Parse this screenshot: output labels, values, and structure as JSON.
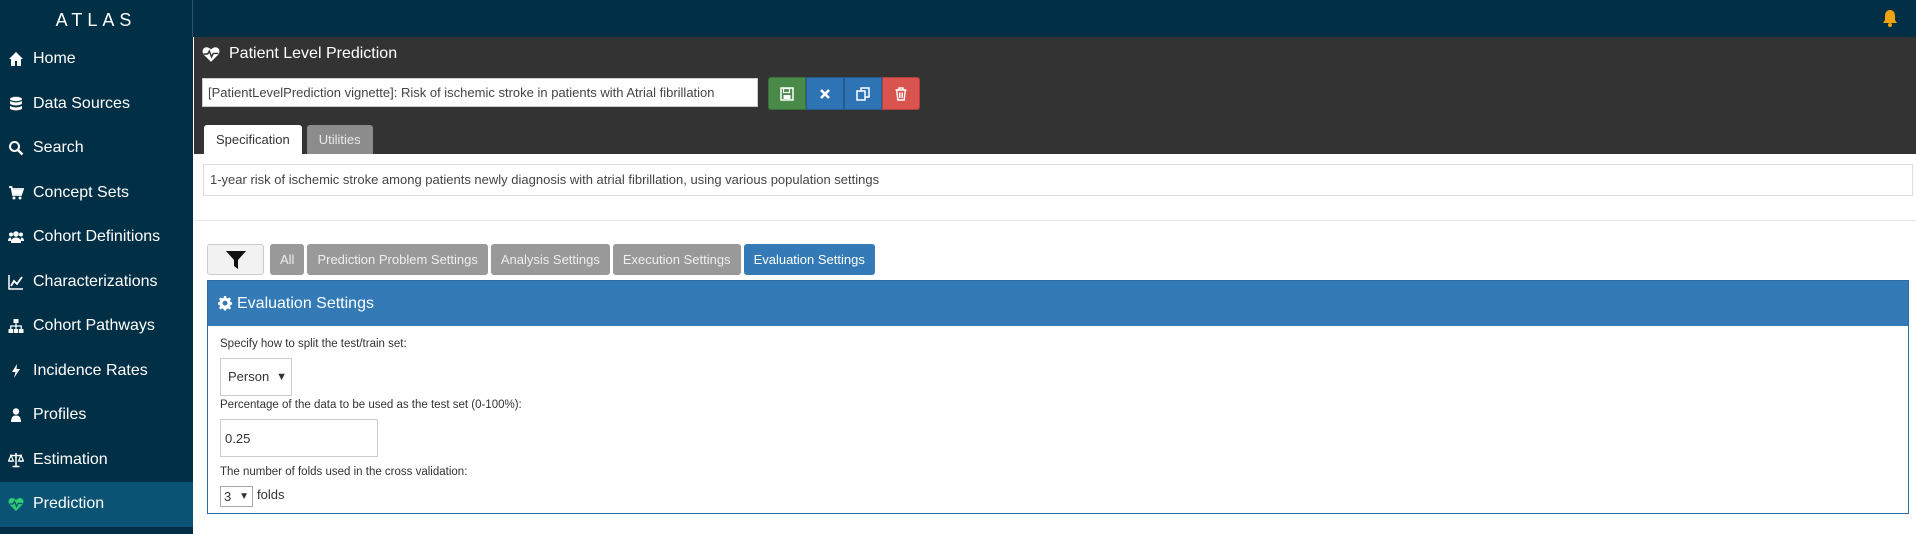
{
  "app": {
    "brand": "ATLAS"
  },
  "nav": {
    "items": [
      {
        "label": "Home",
        "icon": "home-icon"
      },
      {
        "label": "Data Sources",
        "icon": "database-icon"
      },
      {
        "label": "Search",
        "icon": "search-icon"
      },
      {
        "label": "Concept Sets",
        "icon": "cart-icon"
      },
      {
        "label": "Cohort Definitions",
        "icon": "users-icon"
      },
      {
        "label": "Characterizations",
        "icon": "line-chart-icon"
      },
      {
        "label": "Cohort Pathways",
        "icon": "sitemap-icon"
      },
      {
        "label": "Incidence Rates",
        "icon": "bolt-icon"
      },
      {
        "label": "Profiles",
        "icon": "user-icon"
      },
      {
        "label": "Estimation",
        "icon": "balance-scale-icon"
      },
      {
        "label": "Prediction",
        "icon": "heartbeat-icon"
      }
    ],
    "active_index": 10
  },
  "header": {
    "title": "Patient Level Prediction",
    "name_value": "[PatientLevelPrediction vignette]: Risk of ischemic stroke in patients with Atrial fibrillation",
    "tabs": [
      {
        "label": "Specification",
        "active": true
      },
      {
        "label": "Utilities",
        "active": false
      }
    ]
  },
  "description": "1-year risk of ischemic stroke among patients newly diagnosis with atrial fibrillation, using various population settings",
  "filters": {
    "buttons": [
      {
        "label": "All",
        "active": false
      },
      {
        "label": "Prediction Problem Settings",
        "active": false
      },
      {
        "label": "Analysis Settings",
        "active": false
      },
      {
        "label": "Execution Settings",
        "active": false
      },
      {
        "label": "Evaluation Settings",
        "active": true
      }
    ]
  },
  "panel": {
    "title": "Evaluation Settings",
    "split_label": "Specify how to split the test/train set:",
    "split_value": "Person",
    "test_pct_label": "Percentage of the data to be used as the test set (0-100%):",
    "test_pct_value": "0.25",
    "folds_label": "The number of folds used in the cross validation:",
    "folds_value": "3",
    "folds_suffix": "folds"
  },
  "colors": {
    "navbar": "#012f45",
    "nav_active": "#0b5374",
    "header": "#333333",
    "primary": "#337ab7",
    "save": "#4a8a48",
    "delete": "#d9534f",
    "bell": "#f0a30a"
  }
}
